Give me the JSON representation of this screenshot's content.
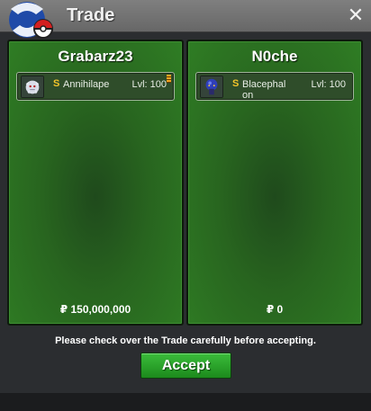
{
  "window": {
    "title": "Trade",
    "close_icon": "✕"
  },
  "trade": {
    "left": {
      "player_name": "Grabarz23",
      "pokemon": {
        "name": "Annihilape",
        "level_label": "Lvl: 100",
        "shiny": "S",
        "icon": "annihilape-sprite-icon",
        "held_item_icon": "held-item-icon"
      },
      "money": "₽ 150,000,000"
    },
    "right": {
      "player_name": "N0che",
      "pokemon": {
        "name": "Blacephalon",
        "level_label": "Lvl: 100",
        "shiny": "S",
        "icon": "blacephalon-sprite-icon"
      },
      "money": "₽ 0"
    }
  },
  "notice": "Please check over the Trade carefully before accepting.",
  "accept_label": "Accept",
  "colors": {
    "panel_green": "#2f7d24",
    "accept_green": "#2aa32a",
    "shiny_gold": "#f2c42a",
    "titlebar": "#737373"
  }
}
